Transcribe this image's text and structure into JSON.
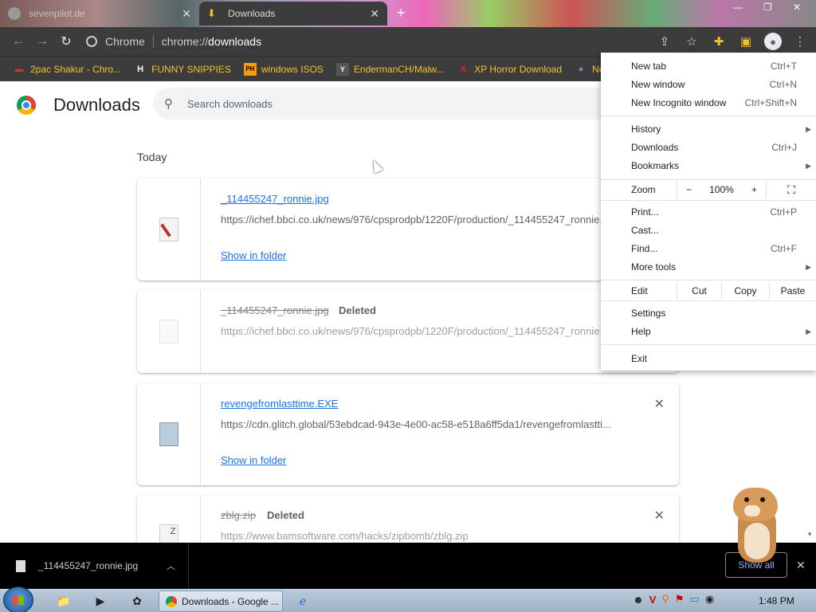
{
  "tabs": [
    {
      "title": "sevenpilot.de"
    },
    {
      "title": "Downloads"
    }
  ],
  "toolbar": {
    "site_label": "Chrome",
    "url_prefix": "chrome://",
    "url_path": "downloads"
  },
  "bookmarks": [
    {
      "label": "2pac Shakur - Chro...",
      "icon": "dinosaur-icon",
      "icon_char": "▬",
      "color": "#c00"
    },
    {
      "label": "FUNNY SNIPPIES",
      "icon": "h-icon",
      "icon_char": "H",
      "color": "#fff"
    },
    {
      "label": "windows ISOS",
      "icon": "ph-icon",
      "icon_char": "PH",
      "color": "#f90"
    },
    {
      "label": "EndermanCH/Malw...",
      "icon": "yp-icon",
      "icon_char": "Y",
      "color": "#888"
    },
    {
      "label": "XP Horror Download",
      "icon": "x-icon",
      "icon_char": "X",
      "color": "#d00"
    },
    {
      "label": "Ne",
      "icon": "globe-icon",
      "icon_char": "●",
      "color": "#a6c"
    }
  ],
  "page": {
    "title": "Downloads",
    "search_placeholder": "Search downloads",
    "section": "Today"
  },
  "downloads": [
    {
      "name": "_114455247_ronnie.jpg",
      "url": "https://ichef.bbci.co.uk/news/976/cpsprodpb/1220F/production/_114455247_ronnie.jpg",
      "status": "",
      "action": "Show in folder"
    },
    {
      "name": "_114455247_ronnie.jpg",
      "url": "https://ichef.bbci.co.uk/news/976/cpsprodpb/1220F/production/_114455247_ronnie.jpg",
      "status": "Deleted",
      "action": ""
    },
    {
      "name": "revengefromlasttime.EXE",
      "url": "https://cdn.glitch.global/53ebdcad-943e-4e00-ac58-e518a6ff5da1/revengefromlasttime.EXE",
      "url_shown": "https://cdn.glitch.global/53ebdcad-943e-4e00-ac58-e518a6ff5da1/revengefromlastti...",
      "status": "",
      "action": "Show in folder"
    },
    {
      "name": "zblg.zip",
      "url": "https://www.bamsoftware.com/hacks/zipbomb/zblg.zip",
      "status": "Deleted",
      "action": ""
    }
  ],
  "menu": {
    "new_tab": "New tab",
    "new_tab_sc": "Ctrl+T",
    "new_window": "New window",
    "new_window_sc": "Ctrl+N",
    "incognito": "New Incognito window",
    "incognito_sc": "Ctrl+Shift+N",
    "history": "History",
    "downloads": "Downloads",
    "downloads_sc": "Ctrl+J",
    "bookmarks": "Bookmarks",
    "zoom": "Zoom",
    "zoom_minus": "−",
    "zoom_value": "100%",
    "zoom_plus": "+",
    "print": "Print...",
    "print_sc": "Ctrl+P",
    "cast": "Cast...",
    "find": "Find...",
    "find_sc": "Ctrl+F",
    "more_tools": "More tools",
    "edit": "Edit",
    "cut": "Cut",
    "copy": "Copy",
    "paste": "Paste",
    "settings": "Settings",
    "help": "Help",
    "exit": "Exit"
  },
  "shelf": {
    "file": "_114455247_ronnie.jpg",
    "show_all": "Show all"
  },
  "taskbar": {
    "chrome_task": "Downloads - Google ...",
    "clock": "1:48 PM"
  }
}
